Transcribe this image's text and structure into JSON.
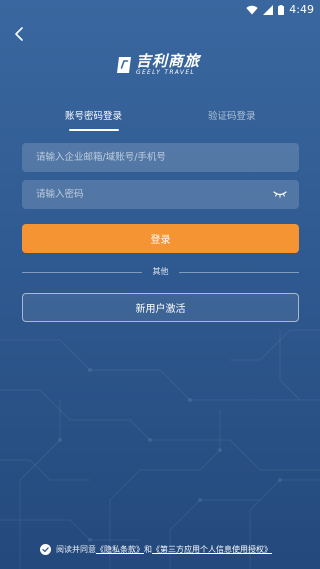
{
  "status_bar": {
    "time": "4:49",
    "icons": [
      "wifi-icon",
      "signal-icon",
      "battery-icon"
    ]
  },
  "header": {
    "back_icon": "back-arrow-icon",
    "logo_cn": "吉利商旅",
    "logo_en": "GEELY TRAVEL"
  },
  "tabs": [
    {
      "label": "账号密码登录",
      "active": true
    },
    {
      "label": "验证码登录",
      "active": false
    }
  ],
  "form": {
    "account_placeholder": "请输入企业邮箱/域账号/手机号",
    "account_value": "",
    "password_placeholder": "请输入密码",
    "password_value": "",
    "password_toggle_icon": "eye-closed-icon"
  },
  "buttons": {
    "login_label": "登录",
    "divider_label": "其他",
    "activate_label": "新用户激活"
  },
  "agreement": {
    "prefix": "阅读并同意",
    "privacy_link": "《隐私条款》",
    "conjunction": "和",
    "authorization_link": "《第三方应用个人信息使用授权》",
    "checked": true
  },
  "colors": {
    "background_top": "#3a679f",
    "background_bottom": "#24497c",
    "login_button": "#f59433",
    "text": "#ffffff"
  }
}
